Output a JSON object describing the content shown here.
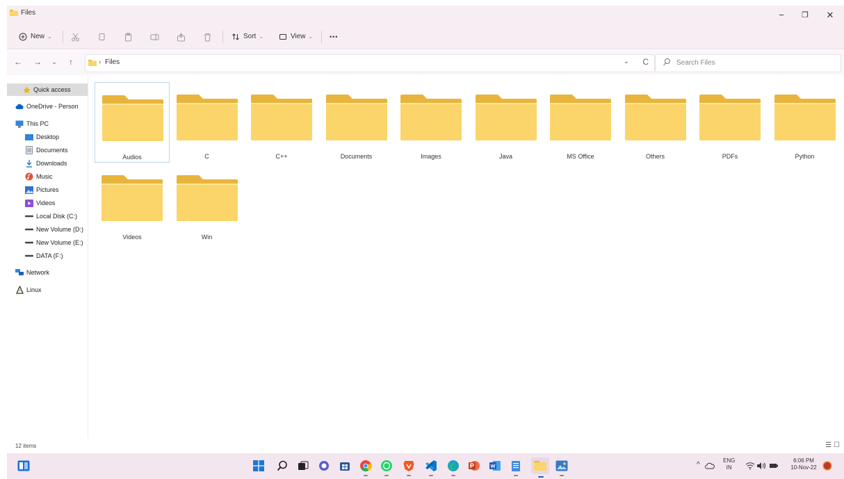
{
  "window": {
    "title": "Files",
    "min_glyph": "−",
    "max_glyph": "❐",
    "close_glyph": "✕"
  },
  "toolbar": {
    "new_label": "New",
    "sort_label": "Sort",
    "view_label": "View",
    "more_label": "•••",
    "dropdown_glyph": "⌄"
  },
  "nav": {
    "back": "←",
    "forward": "→",
    "recent": "⌄",
    "up": "↑"
  },
  "address": {
    "separator": "›",
    "path": "Files",
    "dropdown": "⌄",
    "refresh": "C"
  },
  "search": {
    "placeholder": "Search Files"
  },
  "sidebar": {
    "items": [
      {
        "label": "Quick access",
        "icon": "star-icon"
      },
      {
        "label": "OneDrive - Person",
        "icon": "cloud-icon"
      },
      {
        "label": "This PC",
        "icon": "pc-icon"
      },
      {
        "label": "Desktop",
        "icon": "desktop-icon"
      },
      {
        "label": "Documents",
        "icon": "documents-icon"
      },
      {
        "label": "Downloads",
        "icon": "download-icon"
      },
      {
        "label": "Music",
        "icon": "music-icon"
      },
      {
        "label": "Pictures",
        "icon": "pictures-icon"
      },
      {
        "label": "Videos",
        "icon": "videos-icon"
      },
      {
        "label": "Local Disk (C:)",
        "icon": "drive-icon"
      },
      {
        "label": "New Volume (D:)",
        "icon": "drive-icon"
      },
      {
        "label": "New Volume (E:)",
        "icon": "drive-icon"
      },
      {
        "label": "DATA (F:)",
        "icon": "drive-icon"
      },
      {
        "label": "Network",
        "icon": "network-icon"
      },
      {
        "label": "Linux",
        "icon": "linux-icon"
      }
    ]
  },
  "folders": [
    "Audios",
    "C",
    "C++",
    "Documents",
    "Images",
    "Java",
    "MS Office",
    "Others",
    "PDFs",
    "Python",
    "Videos",
    "Win"
  ],
  "status": {
    "item_count": "12 items",
    "details_glyph": "☰",
    "tiles_glyph": "☐"
  },
  "taskbar": {
    "tray_up": "^",
    "lang": "ENG",
    "region": "IN",
    "time": "6:06 PM",
    "date": "10-Nov-22"
  },
  "colors": {
    "folder_back": "#e9b43c",
    "folder_front": "#fbd46a",
    "accent": "#0a64c8"
  }
}
